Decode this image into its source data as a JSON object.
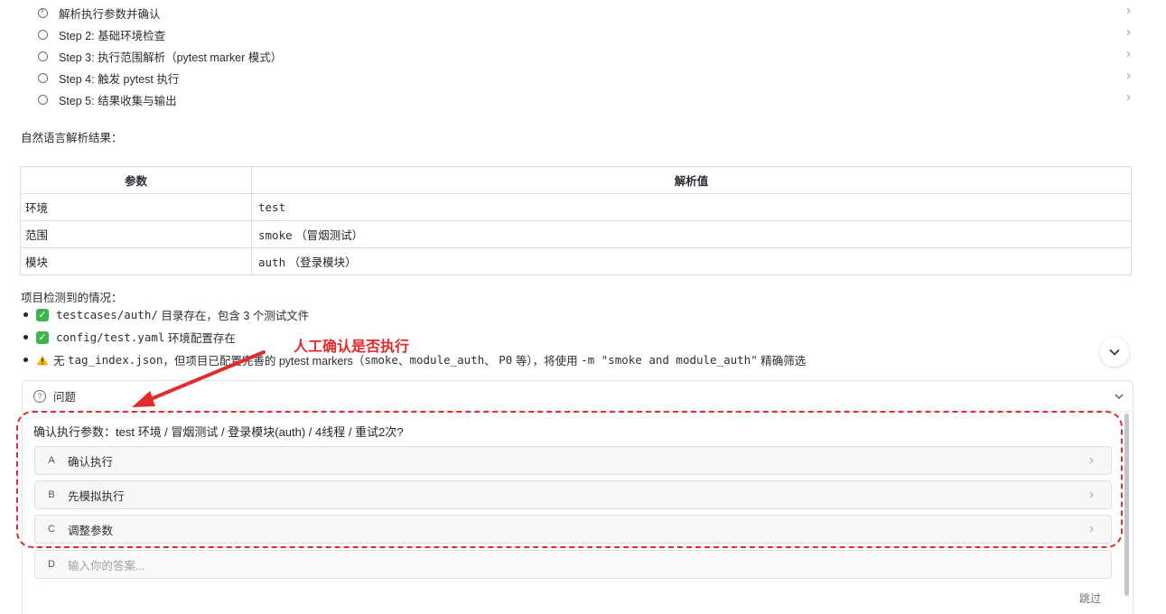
{
  "steps": [
    {
      "label": "解析执行参数并确认",
      "state": "current"
    },
    {
      "label": "Step 2: 基础环境检查",
      "state": "pending"
    },
    {
      "label": "Step 3: 执行范围解析（pytest marker 模式）",
      "state": "pending"
    },
    {
      "label": "Step 4: 触发 pytest 执行",
      "state": "pending"
    },
    {
      "label": "Step 5: 结果收集与输出",
      "state": "pending"
    }
  ],
  "nl_title": "自然语言解析结果：",
  "table": {
    "headers": [
      "参数",
      "解析值"
    ],
    "rows": [
      {
        "param": "环境",
        "code": "test",
        "note": ""
      },
      {
        "param": "范围",
        "code": "smoke",
        "note": "（冒烟测试）"
      },
      {
        "param": "模块",
        "code": "auth",
        "note": "（登录模块）"
      }
    ]
  },
  "detect_title": "项目检测到的情况：",
  "bullets": {
    "b1": {
      "code": "testcases/auth/",
      "text": "目录存在，包含 3 个测试文件"
    },
    "b2": {
      "code": "config/test.yaml",
      "text": "环境配置存在"
    },
    "b3": {
      "t1": "无",
      "c1": "tag_index.json",
      "t2": "，但项目已配置完善的 pytest markers（",
      "c2": "smoke",
      "t3": "、",
      "c3": "module_auth",
      "t4": "、",
      "c4": "P0",
      "t5": "等），将使用",
      "c5": "-m \"smoke and module_auth\"",
      "t6": "精确筛选"
    }
  },
  "question": {
    "header": "问题",
    "text": "确认执行参数：test 环境 / 冒烟测试 / 登录模块(auth) / 4线程 / 重试2次?",
    "options": [
      {
        "key": "A",
        "label": "确认执行"
      },
      {
        "key": "B",
        "label": "先模拟执行"
      },
      {
        "key": "C",
        "label": "调整参数"
      }
    ],
    "input": {
      "key": "D",
      "placeholder": "输入你的答案..."
    },
    "skip": "跳过"
  },
  "annotation": {
    "text": "人工确认是否执行",
    "color": "#e22b2b"
  },
  "colors": {
    "check": "#3fb34f",
    "warn": "#f2b705",
    "annotation": "#e22b2b"
  }
}
